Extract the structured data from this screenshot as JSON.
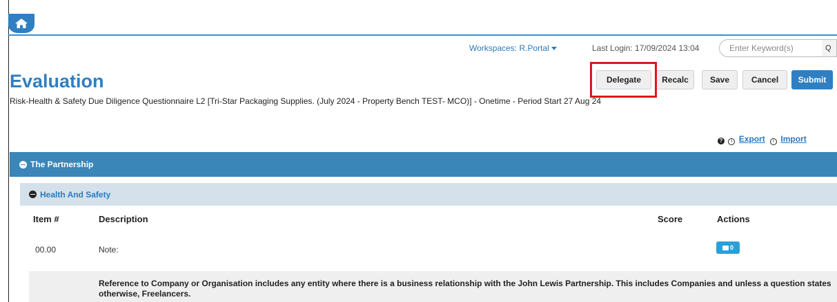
{
  "header": {
    "workspaces_label": "Workspaces: R.Portal",
    "last_login": "Last Login: 17/09/2024 13:04",
    "search_placeholder": "Enter Keyword(s)",
    "search_addon": "Q"
  },
  "page": {
    "title": "Evaluation",
    "subtitle": "Risk-Health & Safety Due Diligence Questionnaire L2 [Tri-Star Packaging Supplies. (July 2024 - Property Bench TEST- MCO)] - Onetime - Period Start 27 Aug 24"
  },
  "toolbar": {
    "delegate": "Delegate",
    "recalc": "Recalc",
    "save": "Save",
    "cancel": "Cancel",
    "submit": "Submit"
  },
  "utility": {
    "export": "Export",
    "import": "Import"
  },
  "section": {
    "title": "The Partnership",
    "subsection": "Health And Safety"
  },
  "table": {
    "headers": {
      "item": "Item #",
      "description": "Description",
      "score": "Score",
      "actions": "Actions"
    },
    "rows": [
      {
        "item": "00.00",
        "description": "Note:",
        "comment_count": "0"
      }
    ],
    "note_text": "Reference to Company or Organisation includes any entity where there is a business relationship with the John Lewis Partnership. This includes Companies and unless a question states otherwise, Freelancers."
  },
  "colors": {
    "accent": "#2f7fc2",
    "section_bar": "#3a86b9",
    "subsection_bar": "#d4e1eb",
    "highlight": "#e0151b"
  }
}
